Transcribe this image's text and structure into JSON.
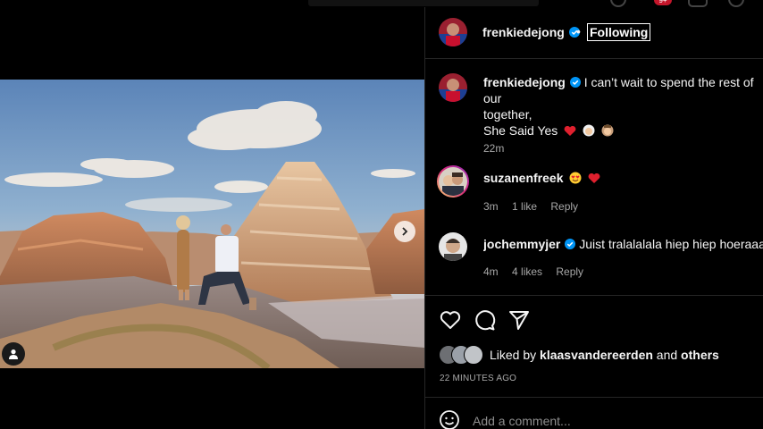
{
  "post": {
    "author": "frenkiedejong",
    "separator": "•",
    "follow_label": "Following",
    "caption_line1": "I can’t wait to spend the rest of our",
    "caption_line2": "together,",
    "caption_line3": "She Said Yes",
    "caption_time": "22m"
  },
  "comments": [
    {
      "user": "suzanenfreek",
      "text": "",
      "time": "3m",
      "likes": "1 like",
      "reply": "Reply"
    },
    {
      "user": "jochemmyjer",
      "text": "Juist tralalalala hiep hiep hoeraaaa",
      "time": "4m",
      "likes": "4 likes",
      "reply": "Reply"
    }
  ],
  "likes": {
    "prefix": "Liked by",
    "user": "klaasvandereerden",
    "and": "and",
    "others": "others"
  },
  "time_ago": "22 MINUTES AGO",
  "add_comment": {
    "placeholder": "Add a comment..."
  },
  "top_badge": "9+",
  "icons": {
    "verified": "verified-badge-icon",
    "like": "heart-icon",
    "comment": "comment-icon",
    "share": "share-icon",
    "next": "chevron-right-icon",
    "tags": "user-tag-icon",
    "emoji": "emoji-icon"
  },
  "colors": {
    "verified": "#0095f6",
    "heart": "#ed4956",
    "background": "#000000",
    "border": "#262626"
  }
}
